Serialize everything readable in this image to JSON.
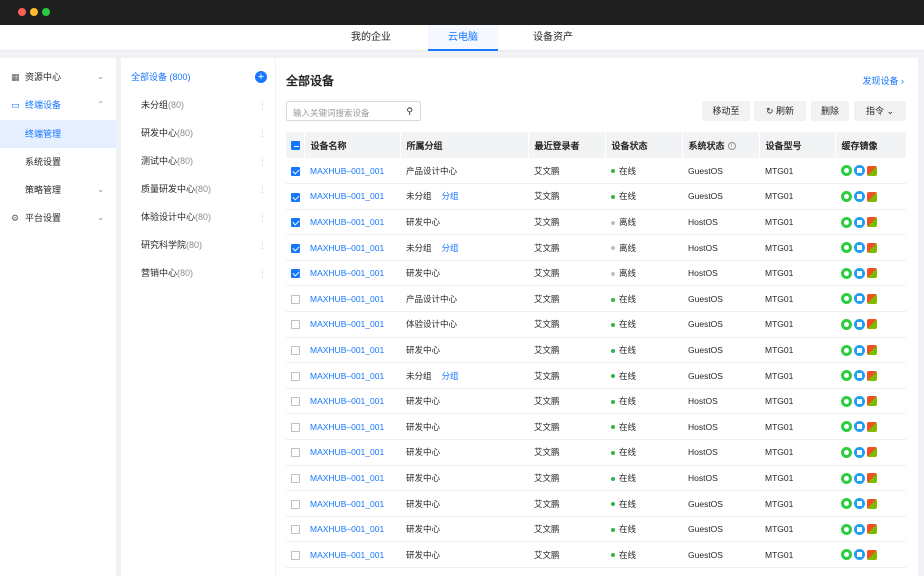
{
  "window": {
    "colors": {
      "close": "#ff5f57",
      "min": "#febc2e",
      "max": "#28c840"
    }
  },
  "nav": {
    "tabs": [
      {
        "label": "我的企业"
      },
      {
        "label": "云电脑"
      },
      {
        "label": "设备资产"
      }
    ],
    "active": "云电脑"
  },
  "sidebar": {
    "items": [
      {
        "label": "资源中心",
        "icon": "grid-icon",
        "chevron": "⌄"
      },
      {
        "label": "终端设备",
        "icon": "monitor-icon",
        "chevron": "⌃"
      },
      {
        "label": "终端管理"
      },
      {
        "label": "系统设置"
      },
      {
        "label": "策略管理",
        "chevron": "⌄"
      },
      {
        "label": "平台设置",
        "icon": "gear-icon",
        "chevron": "⌄"
      }
    ]
  },
  "groups": {
    "all": {
      "label": "全部设备 (800)"
    },
    "items": [
      {
        "name": "未分组",
        "count": "(80)"
      },
      {
        "name": "研发中心",
        "count": "(80)"
      },
      {
        "name": "测试中心",
        "count": "(80)"
      },
      {
        "name": "质量研发中心",
        "count": "(80)"
      },
      {
        "name": "体验设计中心",
        "count": "(80)"
      },
      {
        "name": "研究科学院",
        "count": "(80)"
      },
      {
        "name": "营销中心",
        "count": "(80)"
      }
    ]
  },
  "main": {
    "title": "全部设备",
    "discover": "发现设备",
    "search_placeholder": "输入关键词搜索设备",
    "buttons": {
      "move": "移动至",
      "refresh": "刷新",
      "delete": "删除",
      "command": "指令"
    },
    "columns": [
      "设备名称",
      "所属分组",
      "最近登录者",
      "设备状态",
      "系统状态",
      "设备型号",
      "缓存镜像"
    ],
    "rows": [
      {
        "checked": true,
        "name": "MAXHUB–001_001",
        "group": "产品设计中心",
        "tag": "",
        "user": "艾文鹏",
        "status": "在线",
        "online": true,
        "os": "GuestOS",
        "model": "MTG01"
      },
      {
        "checked": true,
        "name": "MAXHUB–001_001",
        "group": "未分组",
        "tag": "分组",
        "user": "艾文鹏",
        "status": "在线",
        "online": true,
        "os": "GuestOS",
        "model": "MTG01"
      },
      {
        "checked": true,
        "name": "MAXHUB–001_001",
        "group": "研发中心",
        "tag": "",
        "user": "艾文鹏",
        "status": "离线",
        "online": false,
        "os": "HostOS",
        "model": "MTG01"
      },
      {
        "checked": true,
        "name": "MAXHUB–001_001",
        "group": "未分组",
        "tag": "分组",
        "user": "艾文鹏",
        "status": "离线",
        "online": false,
        "os": "HostOS",
        "model": "MTG01"
      },
      {
        "checked": true,
        "name": "MAXHUB–001_001",
        "group": "研发中心",
        "tag": "",
        "user": "艾文鹏",
        "status": "离线",
        "online": false,
        "os": "HostOS",
        "model": "MTG01"
      },
      {
        "checked": false,
        "name": "MAXHUB–001_001",
        "group": "产品设计中心",
        "tag": "",
        "user": "艾文鹏",
        "status": "在线",
        "online": true,
        "os": "GuestOS",
        "model": "MTG01"
      },
      {
        "checked": false,
        "name": "MAXHUB–001_001",
        "group": "体验设计中心",
        "tag": "",
        "user": "艾文鹏",
        "status": "在线",
        "online": true,
        "os": "GuestOS",
        "model": "MTG01"
      },
      {
        "checked": false,
        "name": "MAXHUB–001_001",
        "group": "研发中心",
        "tag": "",
        "user": "艾文鹏",
        "status": "在线",
        "online": true,
        "os": "GuestOS",
        "model": "MTG01"
      },
      {
        "checked": false,
        "name": "MAXHUB–001_001",
        "group": "未分组",
        "tag": "分组",
        "user": "艾文鹏",
        "status": "在线",
        "online": true,
        "os": "GuestOS",
        "model": "MTG01"
      },
      {
        "checked": false,
        "name": "MAXHUB–001_001",
        "group": "研发中心",
        "tag": "",
        "user": "艾文鹏",
        "status": "在线",
        "online": true,
        "os": "HostOS",
        "model": "MTG01"
      },
      {
        "checked": false,
        "name": "MAXHUB–001_001",
        "group": "研发中心",
        "tag": "",
        "user": "艾文鹏",
        "status": "在线",
        "online": true,
        "os": "HostOS",
        "model": "MTG01"
      },
      {
        "checked": false,
        "name": "MAXHUB–001_001",
        "group": "研发中心",
        "tag": "",
        "user": "艾文鹏",
        "status": "在线",
        "online": true,
        "os": "HostOS",
        "model": "MTG01"
      },
      {
        "checked": false,
        "name": "MAXHUB–001_001",
        "group": "研发中心",
        "tag": "",
        "user": "艾文鹏",
        "status": "在线",
        "online": true,
        "os": "HostOS",
        "model": "MTG01"
      },
      {
        "checked": false,
        "name": "MAXHUB–001_001",
        "group": "研发中心",
        "tag": "",
        "user": "艾文鹏",
        "status": "在线",
        "online": true,
        "os": "GuestOS",
        "model": "MTG01"
      },
      {
        "checked": false,
        "name": "MAXHUB–001_001",
        "group": "研发中心",
        "tag": "",
        "user": "艾文鹏",
        "status": "在线",
        "online": true,
        "os": "GuestOS",
        "model": "MTG01"
      },
      {
        "checked": false,
        "name": "MAXHUB–001_001",
        "group": "研发中心",
        "tag": "",
        "user": "艾文鹏",
        "status": "在线",
        "online": true,
        "os": "GuestOS",
        "model": "MTG01"
      }
    ],
    "cache_icons": [
      "android-icon",
      "windows-icon",
      "windows-xp-icon"
    ]
  }
}
